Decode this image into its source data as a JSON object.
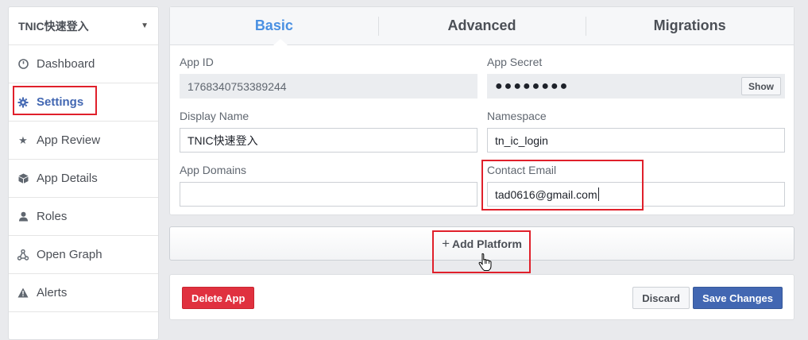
{
  "sidebar": {
    "app_name": "TNIC快速登入",
    "items": [
      {
        "label": "Dashboard",
        "icon": "dashboard-icon"
      },
      {
        "label": "Settings",
        "icon": "gear-icon"
      },
      {
        "label": "App Review",
        "icon": "star-icon"
      },
      {
        "label": "App Details",
        "icon": "cube-icon"
      },
      {
        "label": "Roles",
        "icon": "person-icon"
      },
      {
        "label": "Open Graph",
        "icon": "graph-icon"
      },
      {
        "label": "Alerts",
        "icon": "alert-icon"
      }
    ]
  },
  "tabs": [
    {
      "label": "Basic"
    },
    {
      "label": "Advanced"
    },
    {
      "label": "Migrations"
    }
  ],
  "form": {
    "app_id": {
      "label": "App ID",
      "value": "1768340753389244"
    },
    "app_secret": {
      "label": "App Secret",
      "value": "●●●●●●●●",
      "show_label": "Show"
    },
    "display_name": {
      "label": "Display Name",
      "value": "TNIC快速登入"
    },
    "namespace": {
      "label": "Namespace",
      "value": "tn_ic_login"
    },
    "app_domains": {
      "label": "App Domains",
      "value": ""
    },
    "contact_email": {
      "label": "Contact Email",
      "value": "tad0616@gmail.com"
    }
  },
  "platform": {
    "label": "Add Platform",
    "plus": "+"
  },
  "footer": {
    "delete_label": "Delete App",
    "discard_label": "Discard",
    "save_label": "Save Changes"
  },
  "colors": {
    "accent": "#4a90e2",
    "brand": "#4267b2",
    "danger": "#e0313f",
    "highlight": "#e0202b"
  }
}
